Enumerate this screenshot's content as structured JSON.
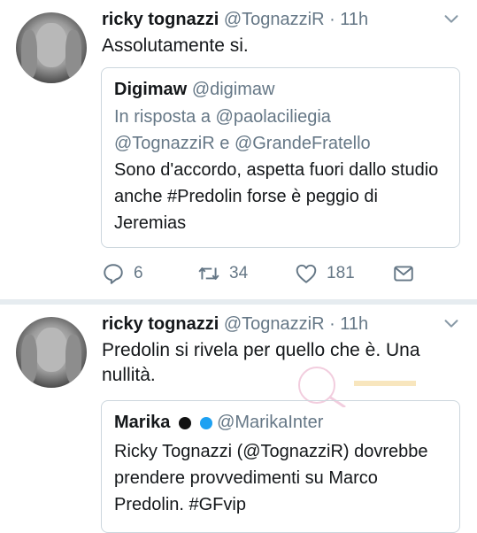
{
  "tweets": [
    {
      "author_name": "ricky tognazzi",
      "author_handle": "@TognazziR",
      "time": "· 11h",
      "text": "Assolutamente si.",
      "quote": {
        "author_name": "Digimaw",
        "author_handle": "@digimaw",
        "reply_prefix": "In risposta a",
        "reply_mentions": [
          "@paolaciliegia",
          "@TognazziR",
          "@GrandeFratello"
        ],
        "reply_conjunction": "e",
        "text": "Sono d'accordo, aspetta fuori dallo studio anche #Predolin forse è peggio di Jeremias"
      },
      "actions": {
        "replies": "6",
        "retweets": "34",
        "likes": "181"
      }
    },
    {
      "author_name": "ricky tognazzi",
      "author_handle": "@TognazziR",
      "time": "· 11h",
      "text": "Predolin si rivela per quello che è. Una nullità.",
      "quote": {
        "author_name": "Marika",
        "author_handle": "@MarikaInter",
        "badge_colors": [
          "#111111",
          "#1da1f2"
        ],
        "text": "Ricky Tognazzi (@TognazziR) dovrebbe prendere provvedimenti su Marco Predolin. #GFvip"
      }
    }
  ],
  "colors": {
    "text": "#14171a",
    "secondary": "#657786",
    "border": "#ccd6dd",
    "separator": "#e6ecf0"
  },
  "icons": [
    "reply-icon",
    "retweet-icon",
    "like-icon",
    "dm-icon",
    "chevron-down-icon"
  ]
}
